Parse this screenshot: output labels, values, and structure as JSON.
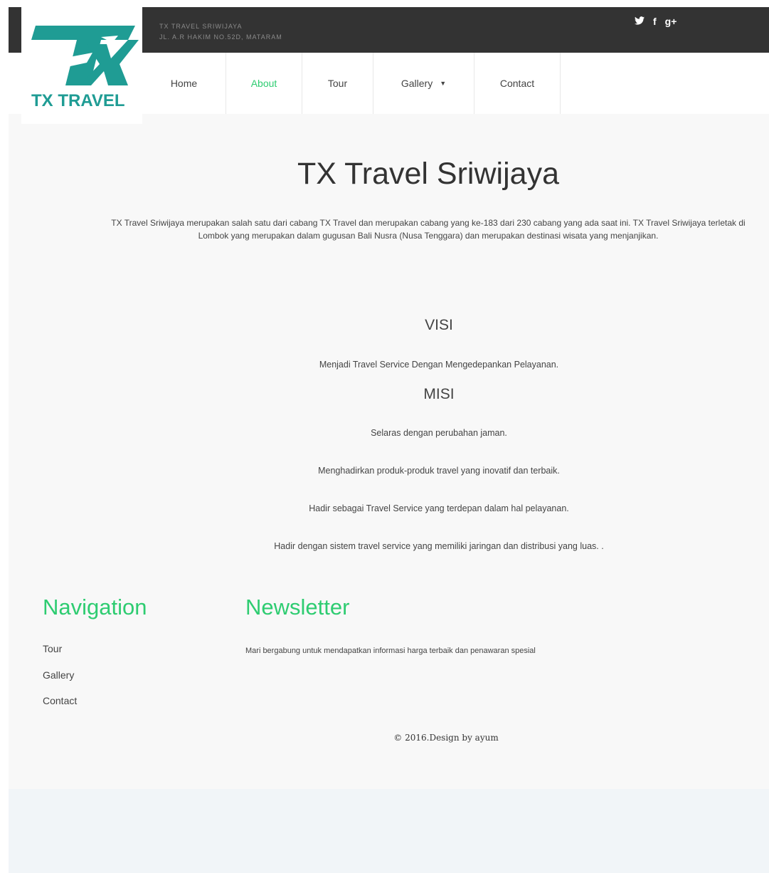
{
  "header": {
    "company_line": "TX TRAVEL SRIWIJAYA",
    "address_line": "JL. A.R HAKIM NO.52D, MATARAM",
    "logo_text": "TX TRAVEL",
    "social": [
      "twitter-icon",
      "facebook-icon",
      "google-plus-icon"
    ],
    "social_glyphs": {
      "twitter": "🐦",
      "facebook": "f",
      "google_plus": "g+"
    }
  },
  "nav": {
    "items": [
      {
        "label": "Home"
      },
      {
        "label": "About"
      },
      {
        "label": "Tour"
      },
      {
        "label": "Gallery"
      },
      {
        "label": "Contact"
      }
    ],
    "active": "About"
  },
  "main": {
    "title": "TX Travel Sriwijaya",
    "intro": "TX Travel Sriwijaya merupakan salah satu dari cabang TX Travel dan merupakan cabang yang ke-183 dari 230 cabang yang ada saat ini. TX Travel Sriwijaya terletak di Lombok yang merupakan dalam gugusan Bali Nusra (Nusa Tenggara) dan merupakan destinasi wisata yang menjanjikan.",
    "visi_heading": "VISI",
    "visi_text": "Menjadi Travel Service Dengan Mengedepankan Pelayanan.",
    "misi_heading": "MISI",
    "misi_items": [
      "Selaras dengan perubahan jaman.",
      "Menghadirkan produk-produk travel yang inovatif dan terbaik.",
      "Hadir sebagai Travel Service yang terdepan dalam hal pelayanan.",
      "Hadir dengan sistem travel service yang memiliki jaringan dan distribusi yang luas. ."
    ]
  },
  "footer": {
    "navigation_heading": "Navigation",
    "navigation_links": [
      "Tour",
      "Gallery",
      "Contact"
    ],
    "newsletter_heading": "Newsletter",
    "newsletter_text": "Mari bergabung untuk mendapatkan informasi harga terbaik dan penawaran spesial",
    "copyright": "© 2016.Design by ayum"
  },
  "colors": {
    "accent": "#2ecc71",
    "topbar": "#333333",
    "logo": "#1f9c94",
    "page_bg": "#f8f8f8"
  }
}
